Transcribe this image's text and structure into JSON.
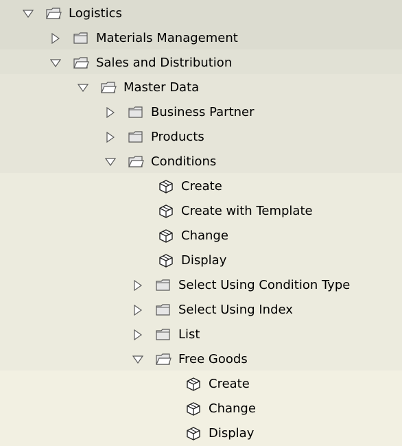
{
  "colors": {
    "band_level0": "#dcdcd0",
    "band_level1": "#e1e1d5",
    "band_level2": "#e6e5d9",
    "band_level3": "#ecebde",
    "band_level4": "#f2f0e2",
    "folder_fill": "#e6e6e6",
    "outline": "#595959"
  },
  "tree": {
    "nodes": [
      {
        "label": "Logistics",
        "level": 0,
        "kind": "folder",
        "state": "expanded"
      },
      {
        "label": "Materials Management",
        "level": 1,
        "kind": "folder",
        "state": "collapsed"
      },
      {
        "label": "Sales and Distribution",
        "level": 1,
        "kind": "folder",
        "state": "expanded"
      },
      {
        "label": "Master Data",
        "level": 2,
        "kind": "folder",
        "state": "expanded"
      },
      {
        "label": "Business Partner",
        "level": 3,
        "kind": "folder",
        "state": "collapsed"
      },
      {
        "label": "Products",
        "level": 3,
        "kind": "folder",
        "state": "collapsed"
      },
      {
        "label": "Conditions",
        "level": 3,
        "kind": "folder",
        "state": "expanded"
      },
      {
        "label": "Create",
        "level": 4,
        "kind": "transaction",
        "state": "leaf"
      },
      {
        "label": "Create with Template",
        "level": 4,
        "kind": "transaction",
        "state": "leaf"
      },
      {
        "label": "Change",
        "level": 4,
        "kind": "transaction",
        "state": "leaf"
      },
      {
        "label": "Display",
        "level": 4,
        "kind": "transaction",
        "state": "leaf"
      },
      {
        "label": "Select Using Condition Type",
        "level": 4,
        "kind": "folder",
        "state": "collapsed"
      },
      {
        "label": "Select Using Index",
        "level": 4,
        "kind": "folder",
        "state": "collapsed"
      },
      {
        "label": "List",
        "level": 4,
        "kind": "folder",
        "state": "collapsed"
      },
      {
        "label": "Free Goods",
        "level": 4,
        "kind": "folder",
        "state": "expanded"
      },
      {
        "label": "Create",
        "level": 5,
        "kind": "transaction",
        "state": "leaf"
      },
      {
        "label": "Change",
        "level": 5,
        "kind": "transaction",
        "state": "leaf"
      },
      {
        "label": "Display",
        "level": 5,
        "kind": "transaction",
        "state": "leaf"
      }
    ]
  }
}
